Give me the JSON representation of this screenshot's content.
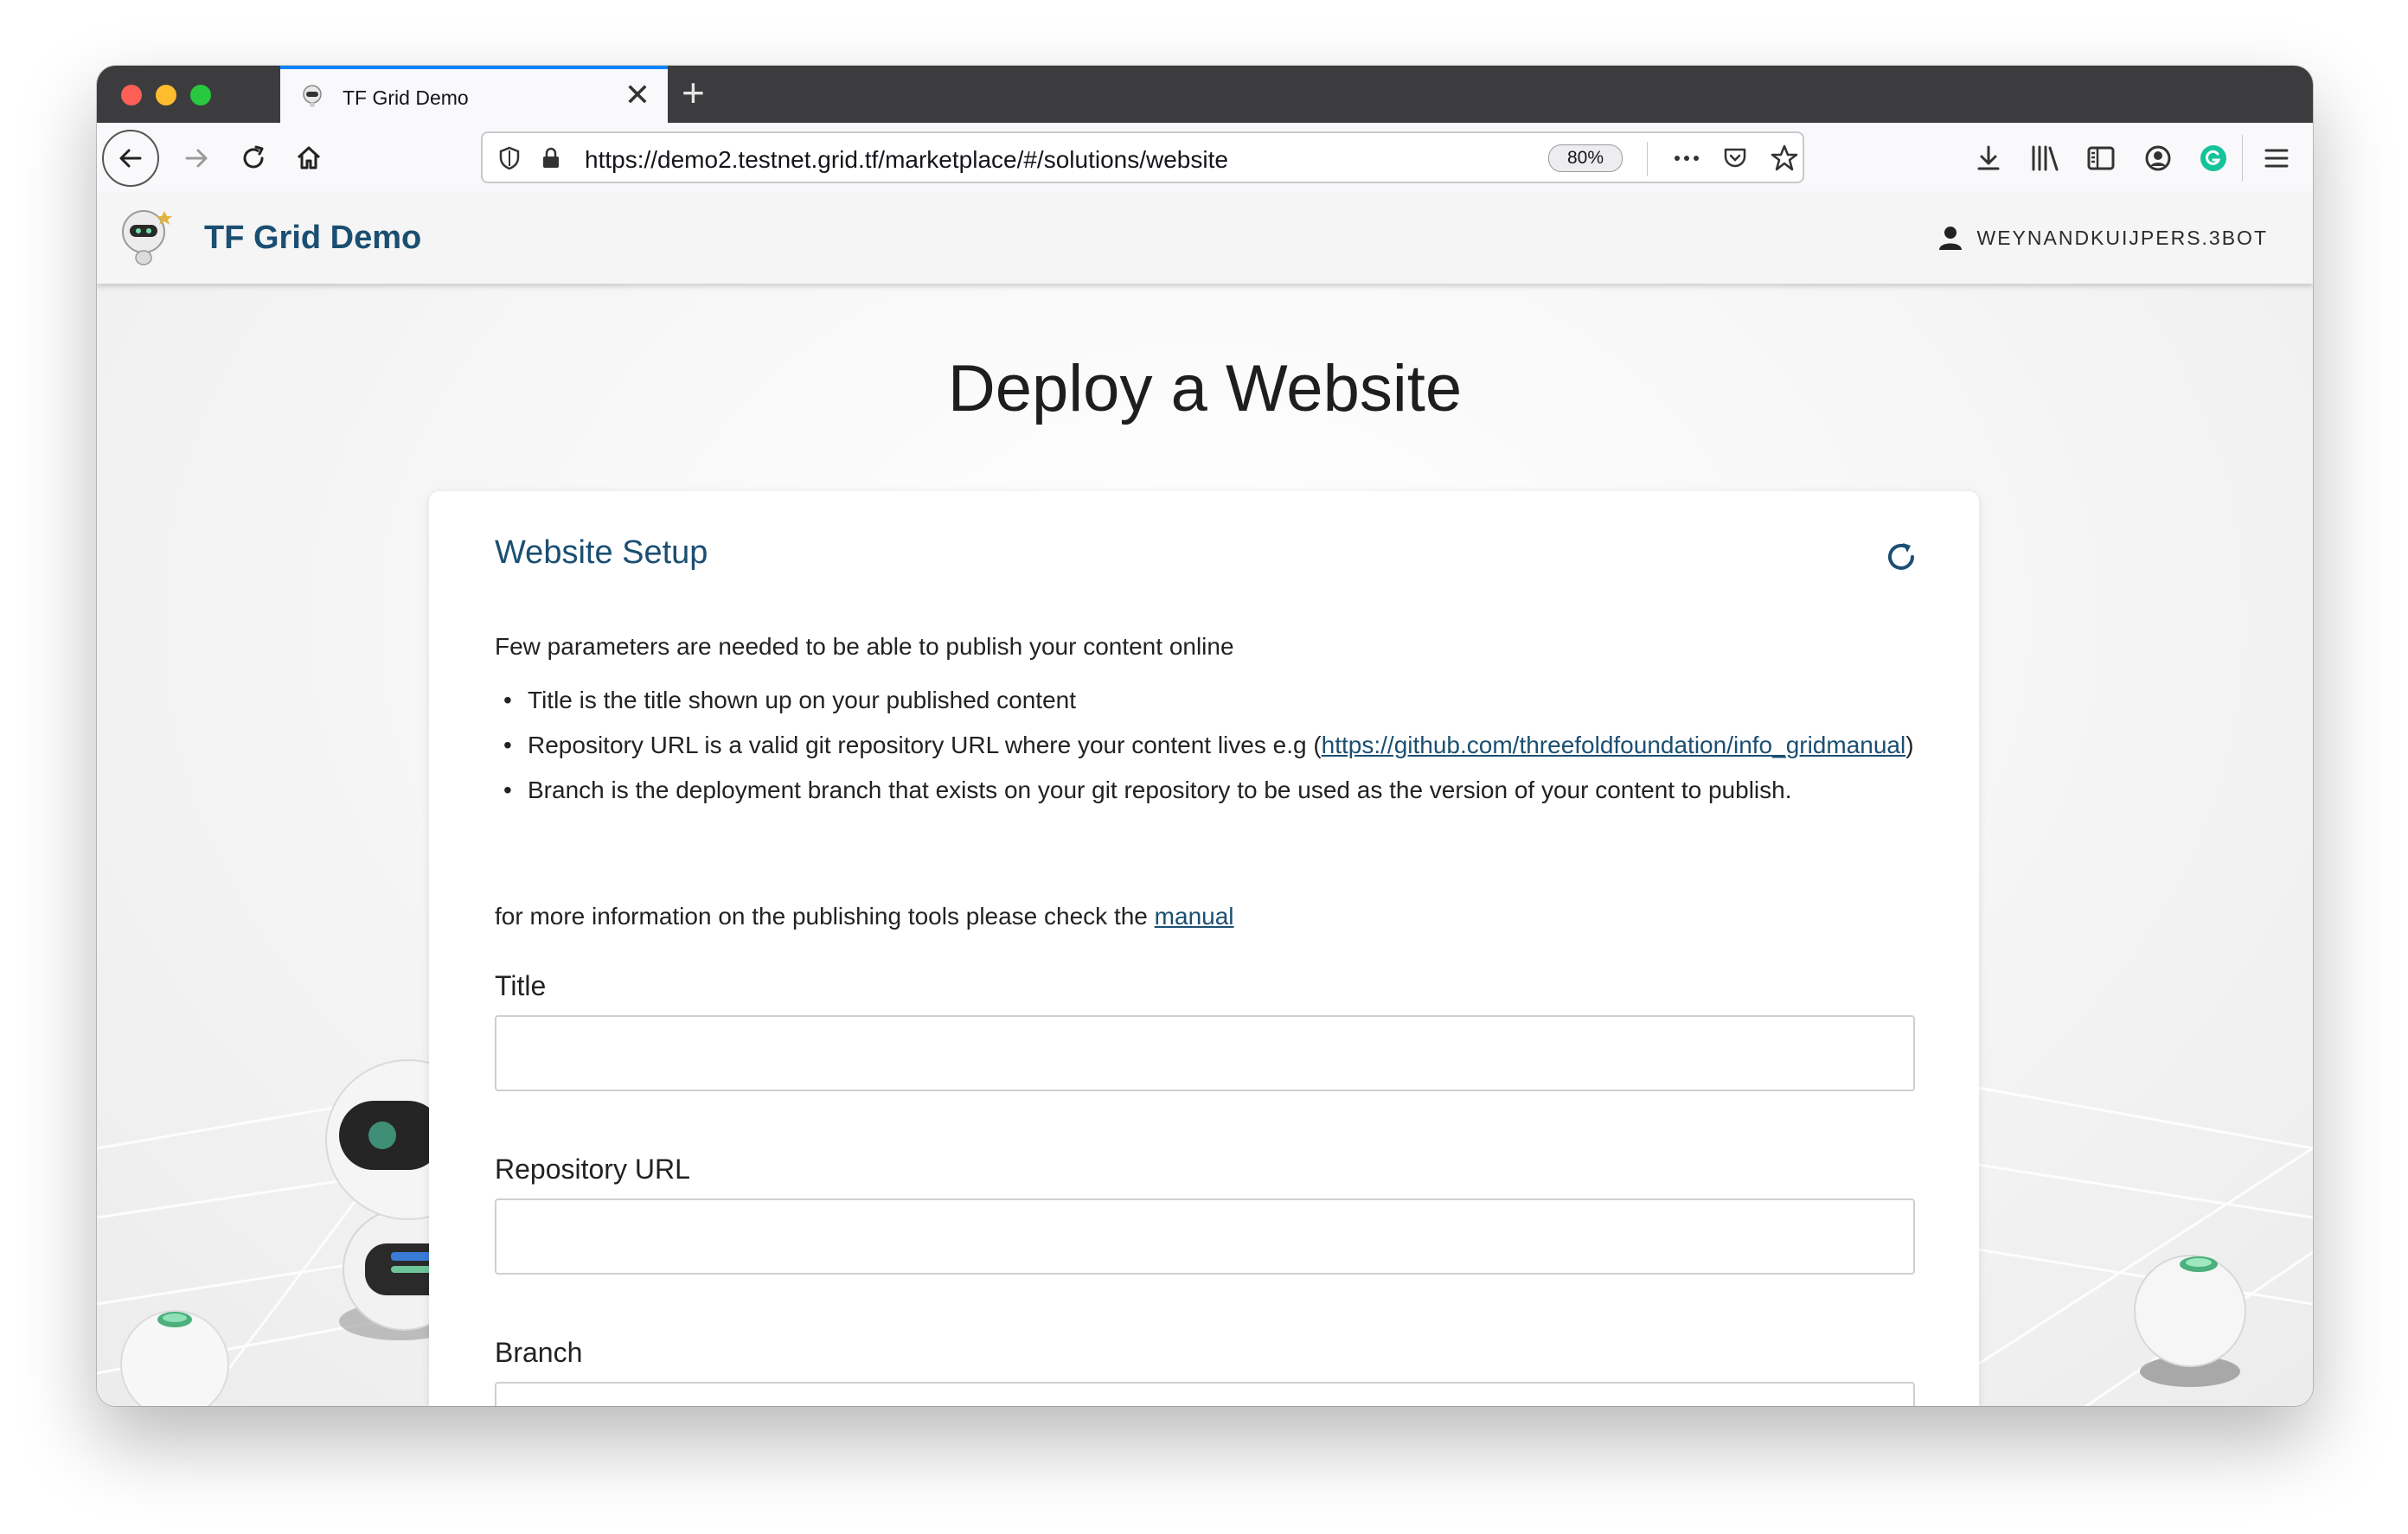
{
  "browser": {
    "tab_title": "TF Grid Demo",
    "tab_close_glyph": "✕",
    "new_tab_glyph": "+",
    "url": "https://demo2.testnet.grid.tf/marketplace/#/solutions/website",
    "zoom": "80%",
    "icons": [
      "back-icon",
      "forward-icon",
      "reload-icon",
      "home-icon",
      "shield-icon",
      "lock-icon",
      "more-icon",
      "pocket-icon",
      "bookmark-star-icon",
      "download-icon",
      "library-icon",
      "sidebar-icon",
      "account-icon",
      "grammarly-icon",
      "menu-icon"
    ]
  },
  "app": {
    "title": "TF Grid Demo",
    "user": "WEYNANDKUIJPERS.3BOT"
  },
  "page": {
    "heading": "Deploy a Website"
  },
  "card": {
    "title": "Website Setup",
    "intro": "Few parameters are needed to be able to publish your content online",
    "bullets": {
      "title": "Title is the title shown up on your published content",
      "repo_prefix": "Repository URL is a valid git repository URL where your content lives e.g (",
      "repo_link": "https://github.com/threefoldfoundation/info_gridmanual",
      "repo_suffix": ")",
      "branch": "Branch is the deployment branch that exists on your git repository to be used as the version of your content to publish."
    },
    "more_prefix": "for more information on the publishing tools please check the ",
    "more_link": "manual",
    "fields": {
      "title_label": "Title",
      "title_value": "",
      "repo_label": "Repository URL",
      "repo_value": "",
      "branch_label": "Branch",
      "branch_value": ""
    }
  },
  "colors": {
    "brand": "#1b4f72",
    "tab_accent": "#0a84ff",
    "titlebar": "#3c3c3e"
  }
}
